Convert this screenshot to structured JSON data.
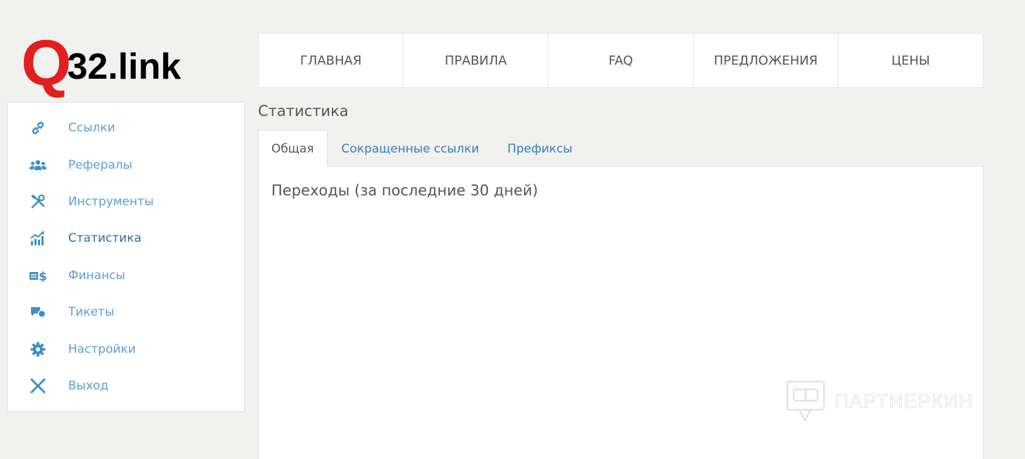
{
  "logo": {
    "q": "Q",
    "rest": "32.link"
  },
  "topnav": {
    "items": [
      {
        "label": "ГЛАВНАЯ"
      },
      {
        "label": "ПРАВИЛА"
      },
      {
        "label": "FAQ"
      },
      {
        "label": "ПРЕДЛОЖЕНИЯ"
      },
      {
        "label": "ЦЕНЫ"
      }
    ]
  },
  "sidebar": {
    "items": [
      {
        "label": "Ссылки",
        "icon": "link-icon"
      },
      {
        "label": "Рефералы",
        "icon": "users-icon"
      },
      {
        "label": "Инструменты",
        "icon": "tools-icon"
      },
      {
        "label": "Статистика",
        "icon": "chart-icon",
        "active": true
      },
      {
        "label": "Финансы",
        "icon": "money-icon"
      },
      {
        "label": "Тикеты",
        "icon": "chat-icon"
      },
      {
        "label": "Настройки",
        "icon": "gear-icon"
      },
      {
        "label": "Выход",
        "icon": "close-icon"
      }
    ]
  },
  "page": {
    "heading": "Статистика"
  },
  "tabs": [
    {
      "label": "Общая",
      "active": true
    },
    {
      "label": "Сокращенные ссылки"
    },
    {
      "label": "Префиксы"
    }
  ],
  "panel": {
    "title": "Переходы (за последние 30 дней)"
  },
  "watermark": {
    "text": "ПАРТНЕРКИН"
  },
  "colors": {
    "accent": "#3d8ec9",
    "brand_red": "#e31e1e",
    "background": "#f1f2f0"
  }
}
